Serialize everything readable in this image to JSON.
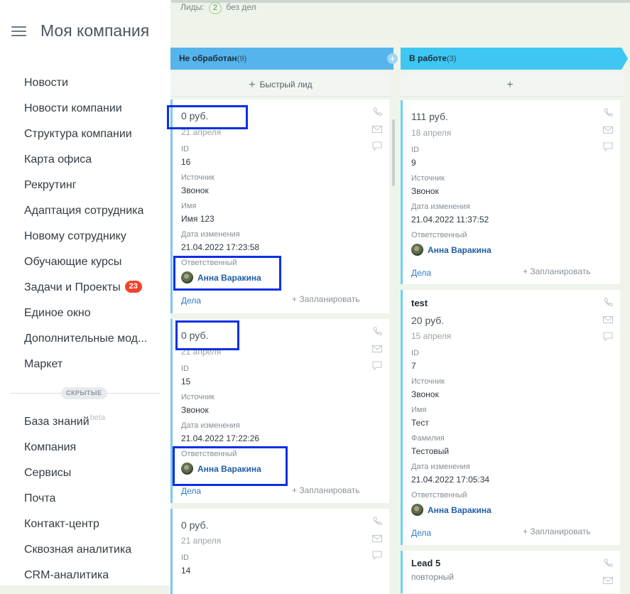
{
  "sidebar": {
    "title": "Моя компания",
    "items": [
      {
        "label": "Новости"
      },
      {
        "label": "Новости компании"
      },
      {
        "label": "Структура компании"
      },
      {
        "label": "Карта офиса"
      },
      {
        "label": "Рекрутинг"
      },
      {
        "label": "Адаптация сотрудника"
      },
      {
        "label": "Новому сотруднику"
      },
      {
        "label": "Обучающие курсы"
      },
      {
        "label": "Задачи и Проекты",
        "badge": "23"
      },
      {
        "label": "Единое окно"
      },
      {
        "label": "Дополнительные мод..."
      },
      {
        "label": "Маркет"
      }
    ],
    "hidden_label": "СКРЫТЫЕ",
    "hidden_items": [
      {
        "label": "База знаний",
        "sup": "beta"
      },
      {
        "label": "Компания"
      },
      {
        "label": "Сервисы"
      },
      {
        "label": "Почта"
      },
      {
        "label": "Контакт-центр"
      },
      {
        "label": "Сквозная аналитика"
      },
      {
        "label": "CRM-аналитика"
      }
    ]
  },
  "filter": {
    "label": "Лиды:",
    "count": "2",
    "suffix": "без дел"
  },
  "columns": [
    {
      "title": "Не обработан",
      "count": "(9)",
      "quick_add": "Быстрый лид",
      "color": "#55b4ec"
    },
    {
      "title": "В работе",
      "count": "(3)",
      "quick_add": "",
      "color": "#3dc7f2"
    }
  ],
  "labels": {
    "id": "ID",
    "source": "Источник",
    "name": "Имя",
    "surname": "Фамилия",
    "modified": "Дата изменения",
    "responsible": "Ответственный",
    "deals": "Дела",
    "plan": "+ Запланировать"
  },
  "col1_cards": [
    {
      "amount": "0 руб.",
      "date": "21 апреля",
      "id": "16",
      "source": "Звонок",
      "name": "Имя 123",
      "modified": "21.04.2022 17:23:58",
      "responsible": "Анна Варакина"
    },
    {
      "amount": "0 руб.",
      "date": "21 апреля",
      "id": "15",
      "source": "Звонок",
      "modified": "21.04.2022 17:22:26",
      "responsible": "Анна Варакина"
    },
    {
      "amount": "0 руб.",
      "date": "21 апреля",
      "id": "14"
    }
  ],
  "col2_cards": [
    {
      "amount": "111 руб.",
      "date": "18 апреля",
      "id": "9",
      "source": "Звонок",
      "modified": "21.04.2022 11:37:52",
      "responsible": "Анна Варакина"
    },
    {
      "title": "test",
      "amount": "20 руб.",
      "date": "15 апреля",
      "id": "7",
      "source": "Звонок",
      "name": "Тест",
      "surname": "Тестовый",
      "modified": "21.04.2022 17:05:34",
      "responsible": "Анна Варакина"
    },
    {
      "title": "Lead 5",
      "subtitle": "повторный"
    }
  ]
}
